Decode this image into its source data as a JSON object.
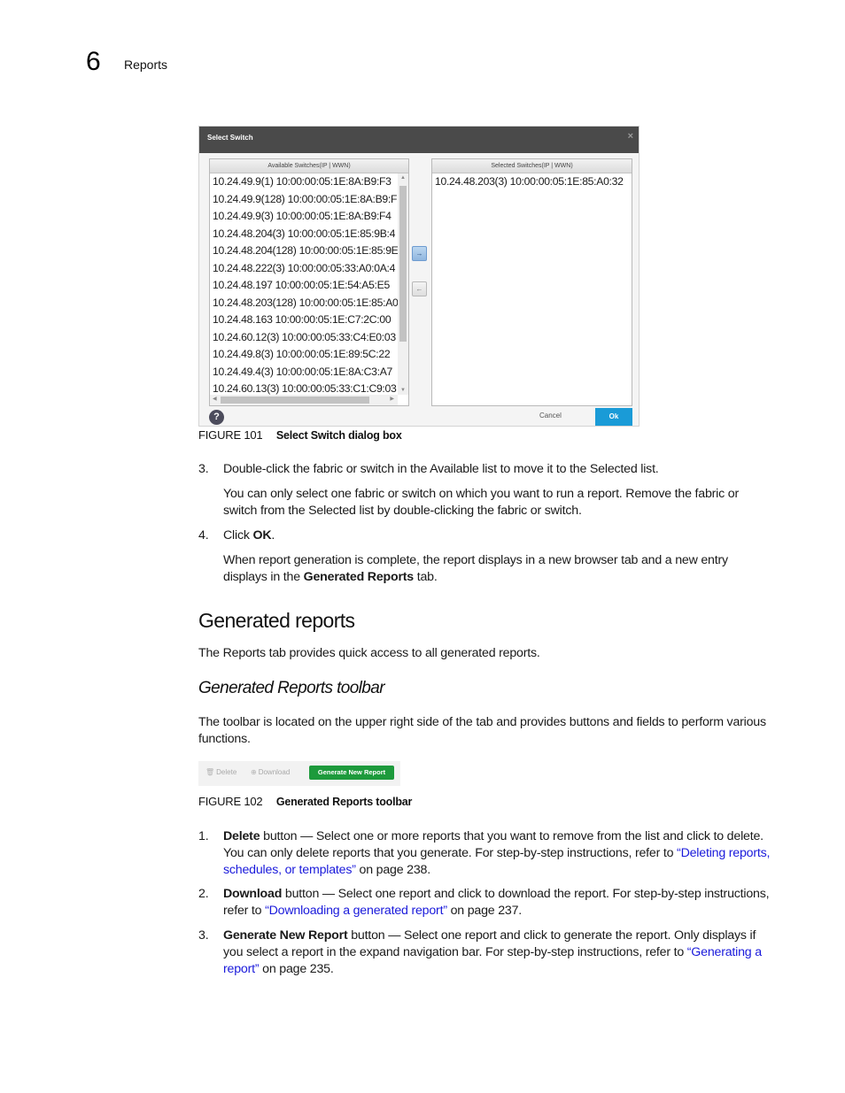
{
  "header": {
    "chapter_number": "6",
    "chapter_title": "Reports"
  },
  "figure101": {
    "dialog": {
      "title": "Select Switch",
      "close_icon": "×",
      "available_header": "Available Switches(IP | WWN)",
      "selected_header": "Selected Switches(IP | WWN)",
      "available_items": [
        "10.24.49.9(1) 10:00:00:05:1E:8A:B9:F3",
        "10.24.49.9(128) 10:00:00:05:1E:8A:B9:F",
        "10.24.49.9(3) 10:00:00:05:1E:8A:B9:F4",
        "10.24.48.204(3) 10:00:00:05:1E:85:9B:4",
        "10.24.48.204(128) 10:00:00:05:1E:85:9E",
        "10.24.48.222(3) 10:00:00:05:33:A0:0A:4",
        "10.24.48.197 10:00:00:05:1E:54:A5:E5",
        "10.24.48.203(128) 10:00:00:05:1E:85:A0",
        "10.24.48.163 10:00:00:05:1E:C7:2C:00",
        "10.24.60.12(3) 10:00:00:05:33:C4:E0:03",
        "10.24.49.8(3) 10:00:00:05:1E:89:5C:22",
        "10.24.49.4(3) 10:00:00:05:1E:8A:C3:A7",
        "10.24.60.13(3) 10:00:00:05:33:C1:C9:03"
      ],
      "selected_items": [
        "10.24.48.203(3) 10:00:00:05:1E:85:A0:32"
      ],
      "move_right_label": "→",
      "move_left_label": "←",
      "help_label": "?",
      "cancel_label": "Cancel",
      "ok_label": "Ok",
      "ok_color": "#1a9bd7"
    },
    "caption_label": "FIGURE 101",
    "caption_text": "Select Switch dialog box"
  },
  "steps_a": [
    {
      "num": "3.",
      "text": "Double-click the fabric or switch in the Available list to move it to the Selected list.",
      "note": "You can only select one fabric or switch on which you want to run a report. Remove the fabric or switch from the Selected list by double-clicking the fabric or switch."
    },
    {
      "num": "4.",
      "text_pre": "Click ",
      "text_bold": "OK",
      "text_post": ".",
      "note_pre": "When report generation is complete, the report displays in a new browser tab and a new entry displays in the ",
      "note_bold": "Generated Reports",
      "note_post": " tab."
    }
  ],
  "section": {
    "heading": "Generated reports",
    "intro": "The Reports tab provides quick access to all generated reports.",
    "subheading": "Generated Reports toolbar",
    "sub_intro": "The toolbar is located on the upper right side of the tab and provides buttons and fields to perform various functions."
  },
  "figure102": {
    "toolbar": {
      "delete_label": "Delete",
      "download_label": "Download",
      "generate_label": "Generate New Report",
      "generate_color": "#1d9a3c"
    },
    "caption_label": "FIGURE 102",
    "caption_text": "Generated Reports toolbar"
  },
  "steps_b": [
    {
      "num": "1.",
      "bold": "Delete",
      "text": " button — Select one or more reports that you want to remove from the list and click to delete. You can only delete reports that you generate. For step-by-step instructions, refer to ",
      "link": "“Deleting reports, schedules, or templates”",
      "post": " on page 238."
    },
    {
      "num": "2.",
      "bold": "Download",
      "text": " button — Select one report and click to download the report. For step-by-step instructions, refer to ",
      "link": "“Downloading a generated report”",
      "post": " on page 237."
    },
    {
      "num": "3.",
      "bold": "Generate New Report",
      "text": " button — Select one report and click to generate the report. Only displays if you select a report in the expand navigation bar. For step-by-step instructions, refer to ",
      "link": "“Generating a report”",
      "post": " on page 235."
    }
  ],
  "colors": {
    "link": "#1a1adb",
    "dialog_header": "#4a4a4a"
  }
}
